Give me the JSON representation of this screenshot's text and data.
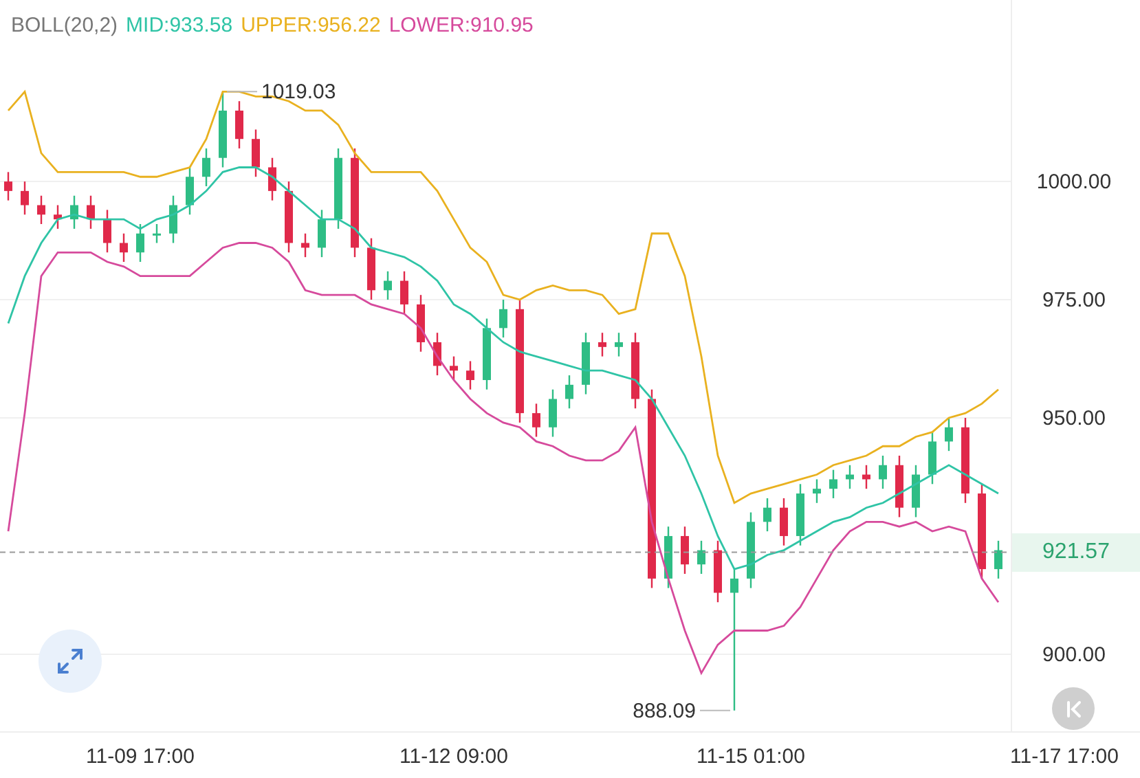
{
  "indicator": {
    "name": "BOLL(20,2)",
    "separator": ":",
    "readings": [
      "933.58",
      "956.22",
      "910.95"
    ]
  },
  "chart_data": {
    "type": "candlestick",
    "categories": [
      null,
      null,
      null,
      null,
      null,
      null,
      null,
      null,
      "11-09 17:00",
      null,
      null,
      null,
      null,
      null,
      null,
      null,
      null,
      null,
      null,
      null,
      null,
      null,
      null,
      null,
      null,
      null,
      null,
      "11-12 09:00",
      null,
      null,
      null,
      null,
      null,
      null,
      null,
      null,
      null,
      null,
      null,
      null,
      null,
      null,
      null,
      null,
      null,
      "11-15 01:00",
      null,
      null,
      null,
      null,
      null,
      null,
      null,
      null,
      null,
      null,
      null,
      null,
      null,
      null,
      null,
      null,
      null,
      null,
      "11-17 17:00"
    ],
    "ohlc": [
      [
        1000,
        1002,
        996,
        998
      ],
      [
        998,
        1000,
        993,
        995
      ],
      [
        995,
        997,
        991,
        993
      ],
      [
        993,
        995,
        990,
        992
      ],
      [
        992,
        997,
        990,
        995
      ],
      [
        995,
        997,
        990,
        992
      ],
      [
        992,
        994,
        985,
        987
      ],
      [
        987,
        989,
        983,
        985
      ],
      [
        985,
        991,
        983,
        989
      ],
      [
        989,
        991,
        987,
        989
      ],
      [
        989,
        997,
        987,
        995
      ],
      [
        995,
        1003,
        993,
        1001
      ],
      [
        1001,
        1007,
        999,
        1005
      ],
      [
        1005,
        1019.03,
        1003,
        1015
      ],
      [
        1015,
        1017,
        1007,
        1009
      ],
      [
        1009,
        1011,
        1001,
        1003
      ],
      [
        1003,
        1005,
        996,
        998
      ],
      [
        998,
        1000,
        985,
        987
      ],
      [
        987,
        989,
        984,
        986
      ],
      [
        986,
        994,
        984,
        992
      ],
      [
        992,
        1007,
        990,
        1005
      ],
      [
        1005,
        1007,
        984,
        986
      ],
      [
        986,
        988,
        975,
        977
      ],
      [
        977,
        981,
        975,
        979
      ],
      [
        979,
        981,
        972,
        974
      ],
      [
        974,
        976,
        964,
        966
      ],
      [
        966,
        968,
        959,
        961
      ],
      [
        961,
        963,
        958,
        960
      ],
      [
        960,
        962,
        956,
        958
      ],
      [
        958,
        971,
        956,
        969
      ],
      [
        969,
        975,
        967,
        973
      ],
      [
        973,
        975,
        949,
        951
      ],
      [
        951,
        953,
        946,
        948
      ],
      [
        948,
        956,
        946,
        954
      ],
      [
        954,
        959,
        952,
        957
      ],
      [
        957,
        968,
        955,
        966
      ],
      [
        966,
        968,
        963,
        965
      ],
      [
        965,
        968,
        963,
        966
      ],
      [
        966,
        968,
        952,
        954
      ],
      [
        954,
        956,
        914,
        916
      ],
      [
        916,
        927,
        914,
        925
      ],
      [
        925,
        927,
        917,
        919
      ],
      [
        919,
        924,
        917,
        922
      ],
      [
        922,
        924,
        911,
        913
      ],
      [
        913,
        918,
        888.09,
        916
      ],
      [
        916,
        930,
        914,
        928
      ],
      [
        928,
        933,
        926,
        931
      ],
      [
        931,
        933,
        923,
        925
      ],
      [
        925,
        936,
        923,
        934
      ],
      [
        934,
        937,
        932,
        935
      ],
      [
        935,
        939,
        933,
        937
      ],
      [
        937,
        940,
        935,
        938
      ],
      [
        938,
        940,
        935,
        937
      ],
      [
        937,
        942,
        935,
        940
      ],
      [
        940,
        942,
        929,
        931
      ],
      [
        931,
        940,
        929,
        938
      ],
      [
        938,
        947,
        936,
        945
      ],
      [
        945,
        950,
        943,
        948
      ],
      [
        948,
        950,
        932,
        934
      ],
      [
        934,
        936,
        916,
        918
      ],
      [
        918,
        924,
        916,
        922
      ],
      null,
      null,
      null,
      null
    ],
    "series": [
      {
        "name": "MID",
        "type": "line",
        "color": "#2fc4a6",
        "values": [
          970,
          980,
          987,
          992,
          993,
          992,
          992,
          992,
          990,
          992,
          993,
          995,
          998,
          1002,
          1003,
          1003,
          1001,
          998,
          995,
          992,
          992,
          990,
          986,
          985,
          984,
          982,
          979,
          974,
          972,
          969,
          966,
          964,
          963,
          962,
          961,
          960,
          960,
          959,
          958,
          954,
          948,
          942,
          934,
          925,
          918,
          919,
          921,
          922,
          924,
          926,
          928,
          929,
          931,
          932,
          934,
          936,
          938,
          940,
          938,
          936,
          934,
          null,
          null,
          null,
          null
        ]
      },
      {
        "name": "UPPER",
        "type": "line",
        "color": "#e9b11f",
        "values": [
          1015,
          1019,
          1006,
          1002,
          1002,
          1002,
          1002,
          1002,
          1001,
          1001,
          1002,
          1003,
          1009,
          1019,
          1019,
          1018,
          1018,
          1017,
          1015,
          1015,
          1012,
          1006,
          1002,
          1002,
          1002,
          1002,
          998,
          992,
          986,
          983,
          976,
          975,
          977,
          978,
          977,
          977,
          976,
          972,
          973,
          989,
          989,
          980,
          963,
          942,
          932,
          934,
          935,
          936,
          937,
          938,
          940,
          941,
          942,
          944,
          944,
          946,
          947,
          950,
          951,
          953,
          956,
          null,
          null,
          null,
          null
        ]
      },
      {
        "name": "LOWER",
        "type": "line",
        "color": "#d64a9c",
        "values": [
          926,
          951,
          980,
          985,
          985,
          985,
          983,
          982,
          980,
          980,
          980,
          980,
          983,
          986,
          987,
          987,
          986,
          983,
          977,
          976,
          976,
          976,
          974,
          973,
          972,
          969,
          963,
          958,
          954,
          951,
          949,
          948,
          945,
          944,
          942,
          941,
          941,
          943,
          948,
          928,
          916,
          905,
          896,
          902,
          905,
          905,
          905,
          906,
          910,
          916,
          922,
          926,
          928,
          928,
          927,
          928,
          926,
          927,
          926,
          916,
          911,
          null,
          null,
          null,
          null
        ]
      }
    ],
    "ylim": [
      883.7,
      1038.4
    ],
    "grid": true,
    "ref_lines": [
      {
        "axis": "y",
        "value": 921.57,
        "label": "921.57"
      }
    ],
    "yticks": [
      {
        "value": 1000,
        "label": "1000.00"
      },
      {
        "value": 975,
        "label": "975.00"
      },
      {
        "value": 950,
        "label": "950.00"
      },
      {
        "value": 900,
        "label": "900.00"
      }
    ],
    "annotations": [
      "1019.03",
      "888.09"
    ]
  }
}
